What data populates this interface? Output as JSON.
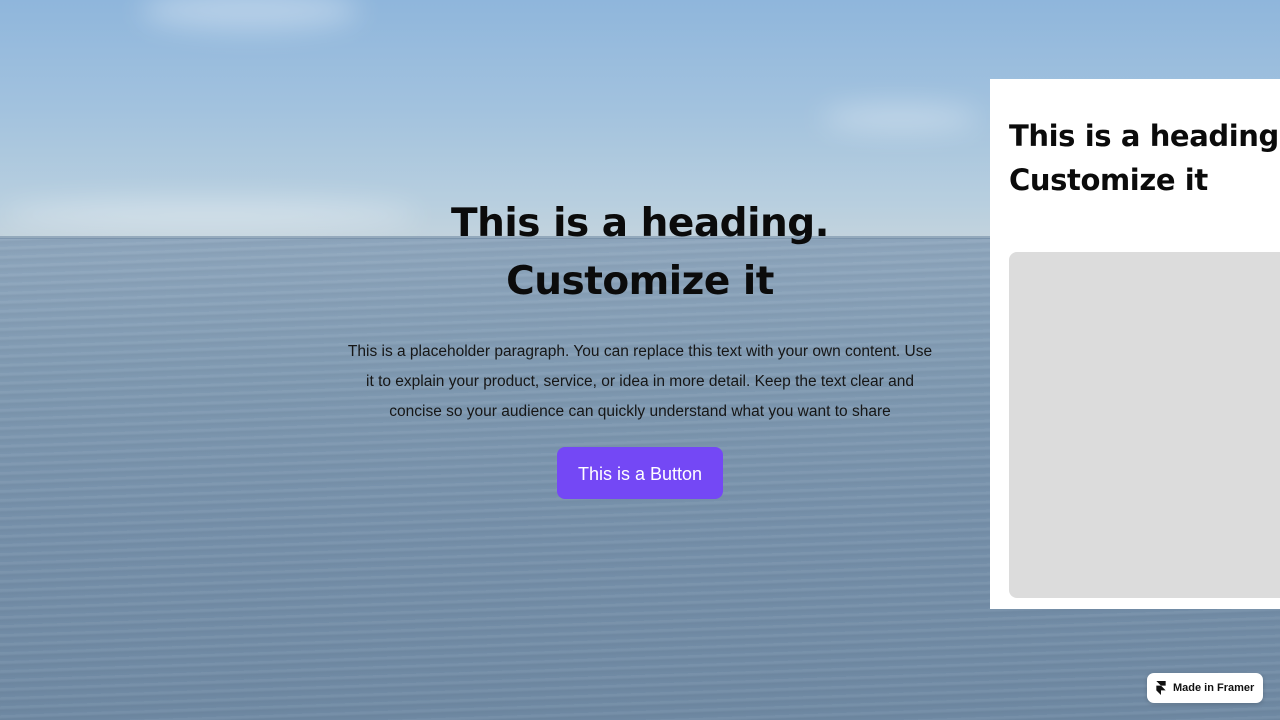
{
  "hero": {
    "title_line1": "This is a heading.",
    "title_line2": "Customize it",
    "paragraph": "This is a placeholder paragraph. You can replace this text with your own content. Use it to explain your product, service, or idea in more detail. Keep the text clear and concise so your audience can quickly understand what you want to share",
    "button_label": "This is a Button"
  },
  "side_card": {
    "title_line1": "This is a heading.",
    "title_line2": "Customize it"
  },
  "badge": {
    "label": "Made in Framer",
    "icon": "framer-logo-icon"
  },
  "colors": {
    "button": "#7448f5",
    "card_background": "#ffffff",
    "image_placeholder": "#dcdcdc"
  }
}
